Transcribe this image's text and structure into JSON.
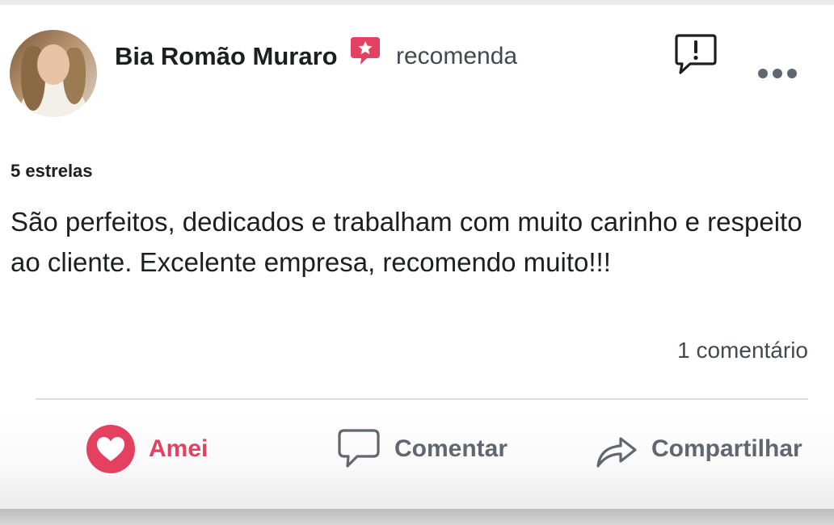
{
  "post": {
    "author_name": "Bia Romão Muraro",
    "action_text": "recomenda",
    "rating_text": "5 estrelas",
    "body": "São perfeitos, dedicados e trabalham com muito carinho e respeito ao cliente. Excelente empresa, recomendo muito!!!",
    "comments_count_text": "1 comentário"
  },
  "actions": {
    "love_label": "Amei",
    "comment_label": "Comentar",
    "share_label": "Compartilhar"
  },
  "icons": {
    "recommend": "recommend-star-badge-icon",
    "report": "report-exclamation-icon",
    "more": "more-options-icon",
    "love": "heart-reaction-icon",
    "comment": "comment-bubble-icon",
    "share": "share-arrow-icon"
  },
  "colors": {
    "accent": "#e4405f",
    "text": "#1c1e21",
    "muted": "#606770"
  }
}
